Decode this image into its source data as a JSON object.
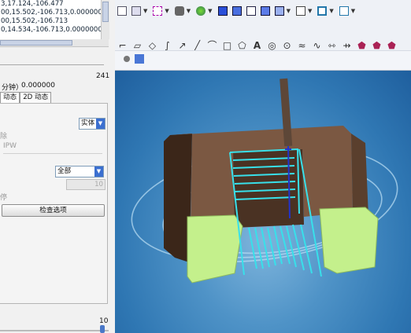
{
  "gcode": {
    "lines": [
      "3,17.124,-106.477",
      "00,15.502,-106.713,0.0000000,",
      "00,15.502,-106.713",
      "0,14.534,-106.713,0.0000000,-("
    ]
  },
  "panel": {
    "counter": "241",
    "time_label": "分钟）",
    "time_value": "0.000000",
    "tabs": [
      "动态",
      "2D 动态"
    ],
    "display_mode": "实体",
    "remove_label": "除",
    "ipw_label": "IPW",
    "scope_value": "全部",
    "step_value": "10",
    "stop_label": "停",
    "check_button": "检查选项",
    "speed_value": "10",
    "accent": "#3b6fd0"
  },
  "toolbar": {
    "row1_icons": [
      "arrow-icon",
      "insert-icon",
      "grid-icon",
      "camera-icon",
      "sphere-icon",
      "cube-icon",
      "cube-icon",
      "cube-icon",
      "cube-icon",
      "cube-icon",
      "square-icon",
      "move-icon",
      "move2-icon"
    ],
    "row2_glyphs": [
      "⌐",
      "▱",
      "◇",
      "∫",
      "↗",
      "╱",
      "⌒",
      "□",
      "⬠",
      "A",
      "◎",
      "⊙",
      "≈",
      "∿",
      "⇿",
      "⇸",
      "⬟",
      "⬟",
      "⬟"
    ]
  },
  "viewport": {
    "background": "#3a82bd",
    "block_color": "#5a3f2d",
    "clamp_color": "#c4f08c",
    "path_color": "#38e0ea",
    "active_path_color": "#2233cc"
  }
}
